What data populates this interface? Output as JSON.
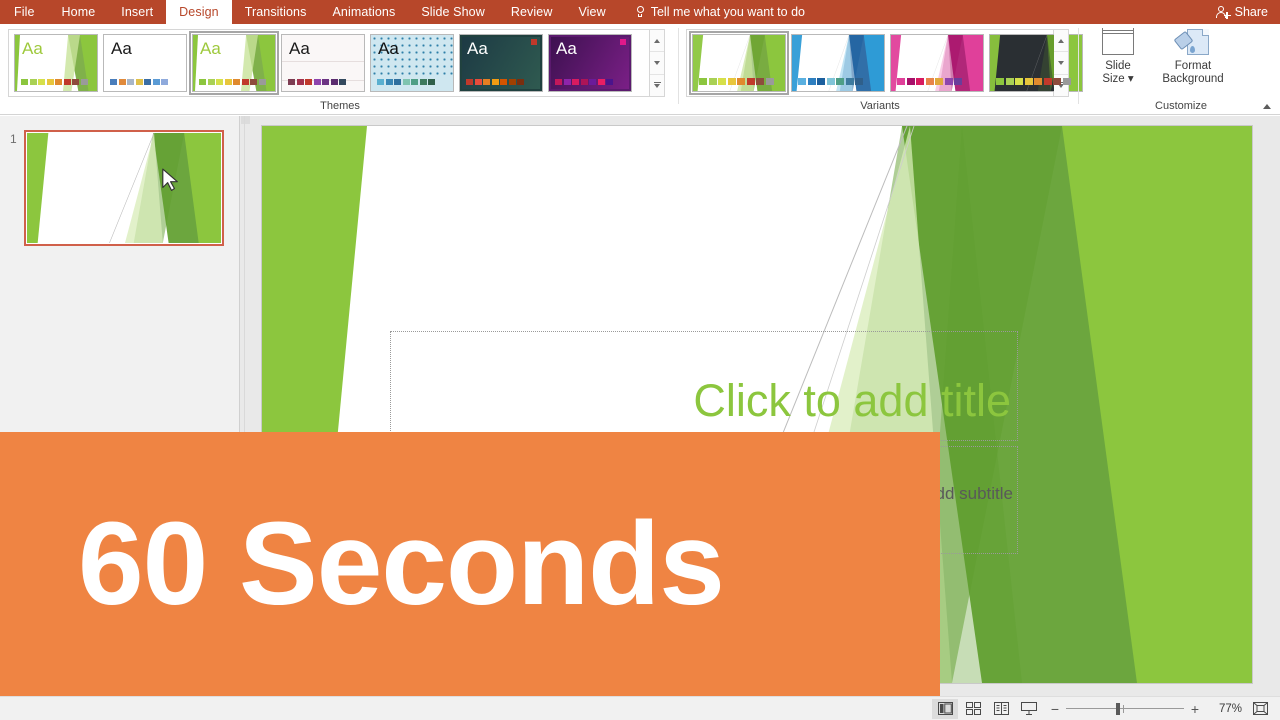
{
  "ribbon": {
    "tabs": [
      {
        "label": "File",
        "active": false
      },
      {
        "label": "Home",
        "active": false
      },
      {
        "label": "Insert",
        "active": false
      },
      {
        "label": "Design",
        "active": true
      },
      {
        "label": "Transitions",
        "active": false
      },
      {
        "label": "Animations",
        "active": false
      },
      {
        "label": "Slide Show",
        "active": false
      },
      {
        "label": "Review",
        "active": false
      },
      {
        "label": "View",
        "active": false
      }
    ],
    "tell_me": "Tell me what you want to do",
    "share": "Share",
    "groups": {
      "themes_label": "Themes",
      "variants_label": "Variants",
      "customize_label": "Customize"
    },
    "customize": {
      "slide_size_line1": "Slide",
      "slide_size_line2": "Size",
      "format_background_line1": "Format",
      "format_background_line2": "Background"
    }
  },
  "themes": [
    {
      "name": "facet-green",
      "selected": false,
      "aa": "Aa",
      "aa_color": "#9ec93c",
      "bg": "#ffffff",
      "leaf": true,
      "leaf_colors": [
        "#8cc63e",
        "#6aa32c",
        "#c8e39a"
      ],
      "swatches": [
        "#8cc63e",
        "#a9d154",
        "#d6e04a",
        "#e8c63c",
        "#e08a2e",
        "#c0392b",
        "#8e4b3c",
        "#9a9a9a"
      ]
    },
    {
      "name": "office-plain",
      "selected": false,
      "aa": "Aa",
      "aa_color": "#1a1a1a",
      "bg": "#ffffff",
      "leaf": false,
      "leaf_colors": [],
      "swatches": [
        "#4a7ebb",
        "#e08a3c",
        "#a8b6c8",
        "#e0c04a",
        "#3a6ea5",
        "#5b9bd5",
        "#8faadc"
      ]
    },
    {
      "name": "facet-green-selected",
      "selected": true,
      "aa": "Aa",
      "aa_color": "#9ec93c",
      "bg": "#ffffff",
      "leaf": true,
      "leaf_colors": [
        "#8cc63e",
        "#6aa32c",
        "#c8e39a"
      ],
      "swatches": [
        "#8cc63e",
        "#a9d154",
        "#d6e04a",
        "#e8c63c",
        "#e08a2e",
        "#c0392b",
        "#8e4b3c",
        "#9a9a9a"
      ]
    },
    {
      "name": "ion-boardroom",
      "selected": false,
      "aa": "Aa",
      "aa_color": "#1a1a1a",
      "bg": "#faf7f7",
      "leaf": false,
      "leaf_colors": [],
      "swatches": [
        "#7d3c52",
        "#a3324e",
        "#c0392b",
        "#8e44ad",
        "#6c3483",
        "#5b2c6f",
        "#34495e"
      ]
    },
    {
      "name": "dotted-pattern",
      "selected": false,
      "aa": "Aa",
      "aa_color": "#111111",
      "bg": "#cfe7f0",
      "leaf": false,
      "leaf_colors": [],
      "swatches": [
        "#5ab0d0",
        "#3a87b5",
        "#2e6f9e",
        "#7fc4b0",
        "#4e9e86",
        "#3d7a5e",
        "#2f5f4a"
      ]
    },
    {
      "name": "dark-teal",
      "selected": false,
      "aa": "Aa",
      "aa_color": "#ffffff",
      "bg": "#20413f",
      "leaf": false,
      "leaf_colors": [],
      "swatches": [
        "#c0392b",
        "#e74c3c",
        "#e67e22",
        "#f39c12",
        "#d35400",
        "#a04000",
        "#7a2e0e"
      ]
    },
    {
      "name": "purple-gradient",
      "selected": false,
      "aa": "Aa",
      "aa_color": "#ffffff",
      "bg": "#5b1a6e",
      "leaf": false,
      "leaf_colors": [],
      "swatches": [
        "#c2185b",
        "#8e24aa",
        "#d81b60",
        "#ad1457",
        "#6a1b9a",
        "#e91e63",
        "#4a148c"
      ]
    }
  ],
  "variants": [
    {
      "name": "variant-green",
      "selected": true,
      "dark": false,
      "c1": "#8cc63e",
      "c2": "#6aa32c",
      "c3": "#c8e39a",
      "swatches": [
        "#8cc63e",
        "#a9d154",
        "#d6e04a",
        "#e8c63c",
        "#e08a2e",
        "#c0392b",
        "#8e4b3c",
        "#9a9a9a"
      ]
    },
    {
      "name": "variant-blue",
      "selected": false,
      "dark": false,
      "c1": "#2e9bd6",
      "c2": "#1b5f9e",
      "c3": "#a8d8f0",
      "swatches": [
        "#5ab0e0",
        "#2e7fc0",
        "#1b5f9e",
        "#7fc4d8",
        "#4e9e86",
        "#3d7a9e",
        "#2f5f8a"
      ]
    },
    {
      "name": "variant-magenta",
      "selected": false,
      "dark": false,
      "c1": "#e0409a",
      "c2": "#a8106a",
      "c3": "#f5b8dc",
      "swatches": [
        "#e0409a",
        "#a8106a",
        "#d81b60",
        "#e8844a",
        "#e0a83c",
        "#8e44ad",
        "#6a3d9a"
      ]
    },
    {
      "name": "variant-dark",
      "selected": false,
      "dark": true,
      "c1": "#8cc63e",
      "c2": "#6aa32c",
      "c3": "#2a2f33",
      "swatches": [
        "#8cc63e",
        "#a9d154",
        "#d6e04a",
        "#e8c63c",
        "#e08a2e",
        "#c0392b",
        "#8e4b3c",
        "#9a9a9a"
      ]
    }
  ],
  "slide_panel": {
    "slide_number": "1"
  },
  "slide": {
    "title_placeholder": "Click to add title",
    "subtitle_placeholder": "Click to add subtitle",
    "theme_green_light": "#8cc63e",
    "theme_green_dark": "#5f9e2e",
    "theme_green_pale": "#d8ecb8"
  },
  "status_bar": {
    "views": [
      "normal-view",
      "slide-sorter-view",
      "reading-view",
      "slide-show-view"
    ],
    "zoom_out": "−",
    "zoom_in": "+",
    "zoom_level": "77%"
  },
  "overlay": {
    "text": "60 Seconds",
    "color": "#ef8443"
  }
}
